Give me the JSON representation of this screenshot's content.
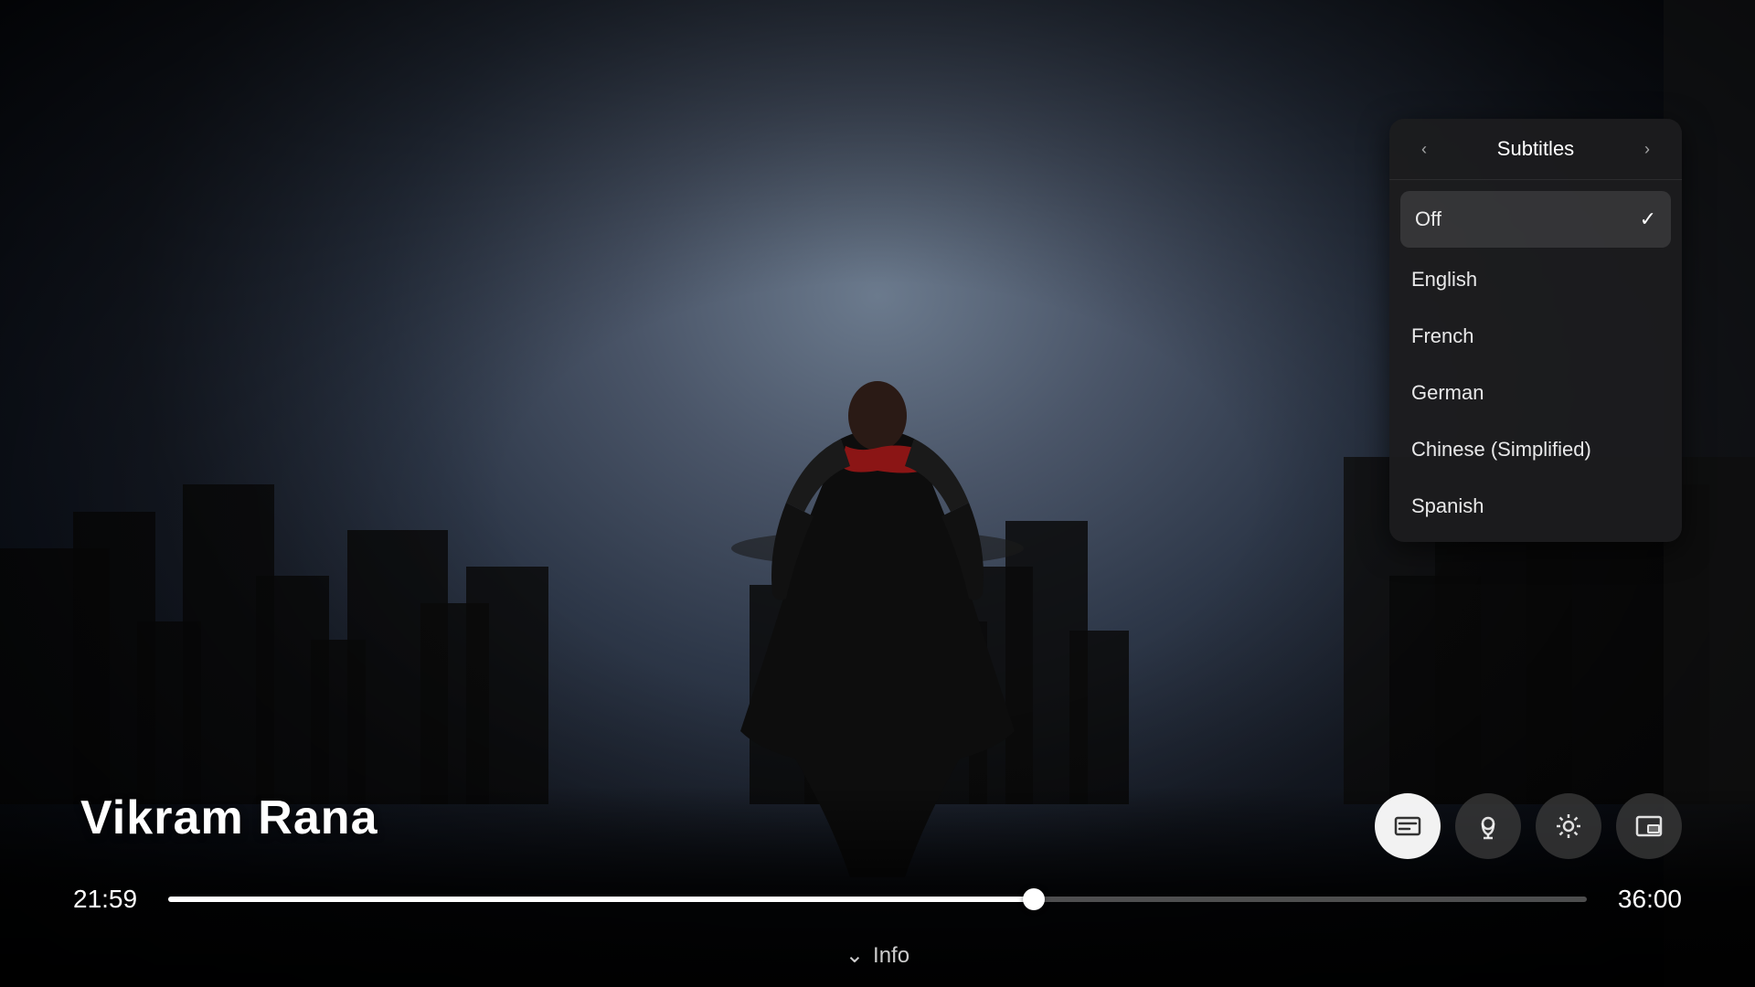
{
  "video": {
    "title": "Vikram Rana",
    "current_time": "21:59",
    "total_time": "36:00",
    "progress_percent": 61
  },
  "controls": {
    "subtitle_icon": "⊟",
    "music_icon": "♪",
    "settings_icon": "⚙",
    "pip_icon": "⧉",
    "info_label": "Info",
    "chevron_down": "⌄"
  },
  "subtitles_panel": {
    "title": "Subtitles",
    "nav_left": "‹",
    "nav_right": "›",
    "options": [
      {
        "id": "off",
        "label": "Off",
        "selected": true
      },
      {
        "id": "english",
        "label": "English",
        "selected": false
      },
      {
        "id": "french",
        "label": "French",
        "selected": false
      },
      {
        "id": "german",
        "label": "German",
        "selected": false
      },
      {
        "id": "chinese-simplified",
        "label": "Chinese (Simplified)",
        "selected": false
      },
      {
        "id": "spanish",
        "label": "Spanish",
        "selected": false
      }
    ],
    "check_mark": "✓"
  }
}
